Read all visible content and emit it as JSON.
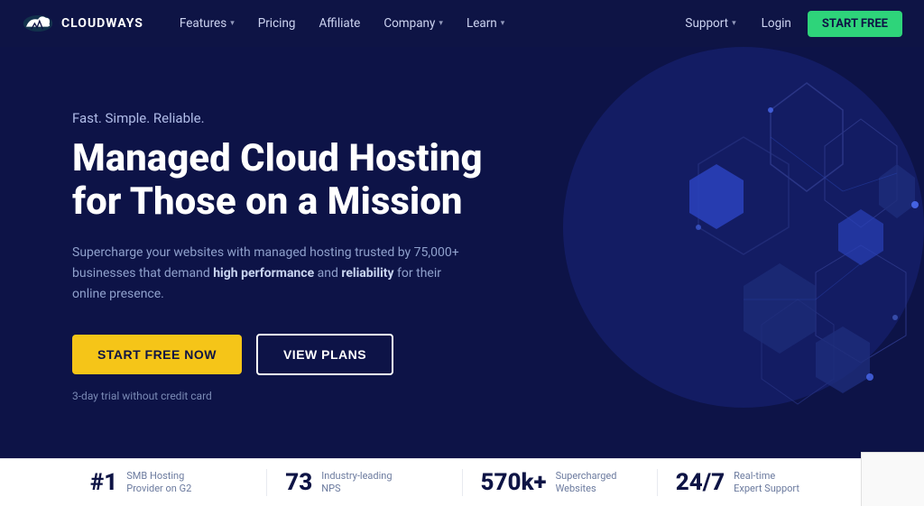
{
  "navbar": {
    "logo_text": "CLOUDWAYS",
    "nav_items": [
      {
        "label": "Features",
        "has_dropdown": true
      },
      {
        "label": "Pricing",
        "has_dropdown": false
      },
      {
        "label": "Affiliate",
        "has_dropdown": false
      },
      {
        "label": "Company",
        "has_dropdown": true
      },
      {
        "label": "Learn",
        "has_dropdown": true
      }
    ],
    "support_label": "Support",
    "login_label": "Login",
    "start_free_label": "START FREE"
  },
  "hero": {
    "subtitle": "Fast. Simple. Reliable.",
    "title": "Managed Cloud Hosting\nfor Those on a Mission",
    "description_part1": "Supercharge your websites with managed hosting trusted by 75,000+ businesses that demand ",
    "description_bold1": "high performance",
    "description_part2": " and ",
    "description_bold2": "reliability",
    "description_part3": " for their online presence.",
    "btn_start_label": "START FREE NOW",
    "btn_plans_label": "VIEW PLANS",
    "trial_note": "3-day trial without credit card"
  },
  "stats": [
    {
      "number": "#1",
      "label": "SMB Hosting\nProvider on G2"
    },
    {
      "number": "73",
      "label": "Industry-leading\nNPS"
    },
    {
      "number": "570k+",
      "label": "Supercharged\nWebsites"
    },
    {
      "number": "24/7",
      "label": "Real-time\nExpert Support"
    }
  ]
}
